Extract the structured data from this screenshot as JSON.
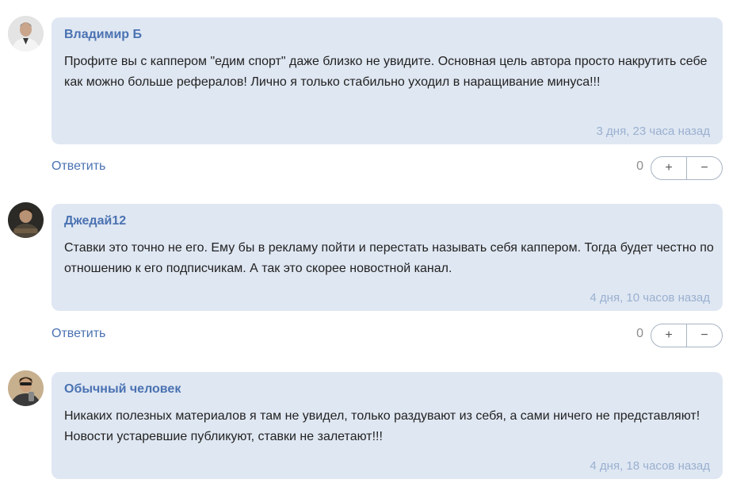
{
  "comments": [
    {
      "author": "Владимир Б",
      "text": "Профите вы с каппером \"едим спорт\" даже близко не увидите. Основная цель автора просто накрутить себе как можно больше рефералов! Лично я только стабильно уходил в наращивание минуса!!!",
      "time": "3 дня, 23 часа назад",
      "reply_label": "Ответить",
      "score": "0",
      "upvote": "+",
      "downvote": "−",
      "avatar_icon": "user-avatar-icon"
    },
    {
      "author": "Джедай12",
      "text": "Ставки это точно не его. Ему бы в рекламу пойти и перестать называть себя каппером. Тогда будет честно по отношению к его подписчикам. А так это скорее новостной канал.",
      "time": "4 дня, 10 часов назад",
      "reply_label": "Ответить",
      "score": "0",
      "upvote": "+",
      "downvote": "−",
      "avatar_icon": "user-avatar-icon"
    },
    {
      "author": "Обычный человек",
      "text": "Никаких полезных материалов я там не увидел, только раздувают из себя, а сами ничего не представляют! Новости устаревшие публикуют, ставки не залетают!!!",
      "time": "4 дня, 18 часов назад",
      "avatar_icon": "user-avatar-icon"
    }
  ],
  "colors": {
    "bubble": "#dfe7f2",
    "author": "#4a72b2",
    "link": "#4a72b2",
    "time": "#9ab0d0",
    "text": "#222222"
  }
}
